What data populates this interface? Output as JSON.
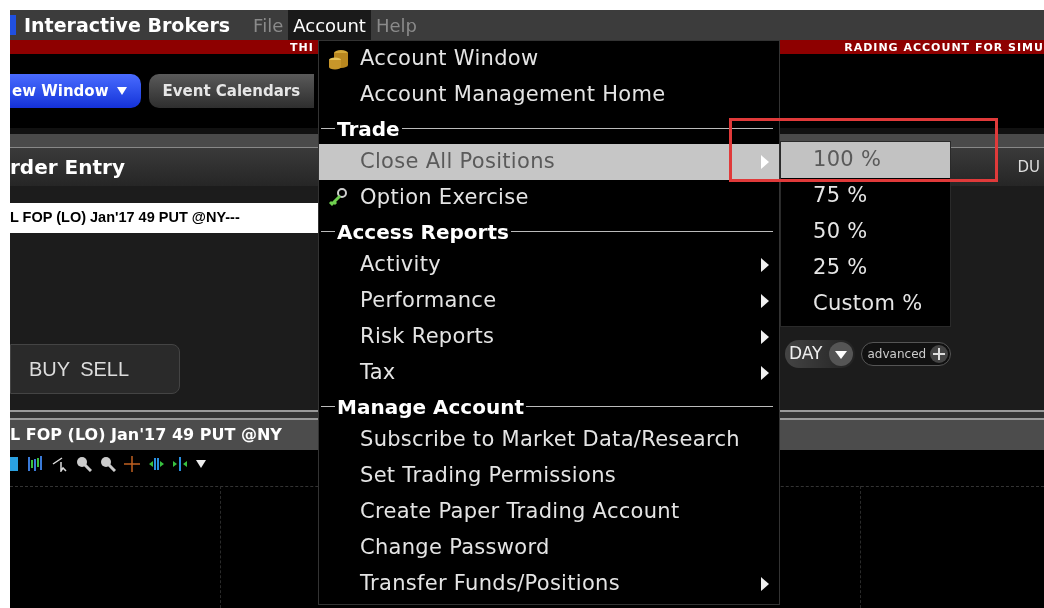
{
  "menu_bar": {
    "app_title": "Interactive Brokers",
    "menus": [
      {
        "label": "File",
        "selected": false
      },
      {
        "label": "Account",
        "selected": true
      },
      {
        "label": "Help",
        "selected": false
      }
    ]
  },
  "banner": [
    "THI",
    "RADING ACCOUNT FOR SIMU"
  ],
  "toolbar": {
    "buttons": [
      {
        "label": "ew Window",
        "kind": "dropdown"
      },
      {
        "label": "Event Calendars",
        "kind": "plain"
      }
    ]
  },
  "order_entry": {
    "title": "rder Entry",
    "column_2": "DU",
    "contract": "L FOP (LO) Jan'17 49 PUT @NY---",
    "side_buttons": [
      "BUY",
      "SELL"
    ],
    "time_in_force": "DAY",
    "advanced_button": "advanced"
  },
  "chart": {
    "title": "L FOP (LO) Jan'17 49 PUT @NY"
  },
  "account_menu": {
    "items": [
      {
        "kind": "item",
        "label": "Account Window",
        "icon": true,
        "submenu": false,
        "selected": false
      },
      {
        "kind": "item",
        "label": "Account Management Home",
        "icon": false,
        "submenu": false,
        "selected": false
      },
      {
        "kind": "header",
        "label": "Trade"
      },
      {
        "kind": "item",
        "label": "Close All Positions",
        "icon": false,
        "submenu": true,
        "selected": true
      },
      {
        "kind": "item",
        "label": "Option Exercise",
        "icon": true,
        "submenu": false,
        "selected": false
      },
      {
        "kind": "header",
        "label": "Access Reports"
      },
      {
        "kind": "item",
        "label": "Activity",
        "icon": false,
        "submenu": true,
        "selected": false
      },
      {
        "kind": "item",
        "label": "Performance",
        "icon": false,
        "submenu": true,
        "selected": false
      },
      {
        "kind": "item",
        "label": "Risk Reports",
        "icon": false,
        "submenu": true,
        "selected": false
      },
      {
        "kind": "item",
        "label": "Tax",
        "icon": false,
        "submenu": true,
        "selected": false
      },
      {
        "kind": "header",
        "label": "Manage Account"
      },
      {
        "kind": "item",
        "label": "Subscribe to Market Data/Research",
        "icon": false,
        "submenu": false,
        "selected": false
      },
      {
        "kind": "item",
        "label": "Set Trading Permissions",
        "icon": false,
        "submenu": false,
        "selected": false
      },
      {
        "kind": "item",
        "label": "Create Paper Trading Account",
        "icon": false,
        "submenu": false,
        "selected": false
      },
      {
        "kind": "item",
        "label": "Change Password",
        "icon": false,
        "submenu": false,
        "selected": false
      },
      {
        "kind": "item",
        "label": "Transfer Funds/Positions",
        "icon": false,
        "submenu": true,
        "selected": false
      }
    ]
  },
  "close_all_submenu": {
    "items": [
      {
        "label": "100 %",
        "selected": true
      },
      {
        "label": "75 %",
        "selected": false
      },
      {
        "label": "50 %",
        "selected": false
      },
      {
        "label": "25 %",
        "selected": false
      },
      {
        "label": "Custom %",
        "selected": false
      }
    ]
  }
}
